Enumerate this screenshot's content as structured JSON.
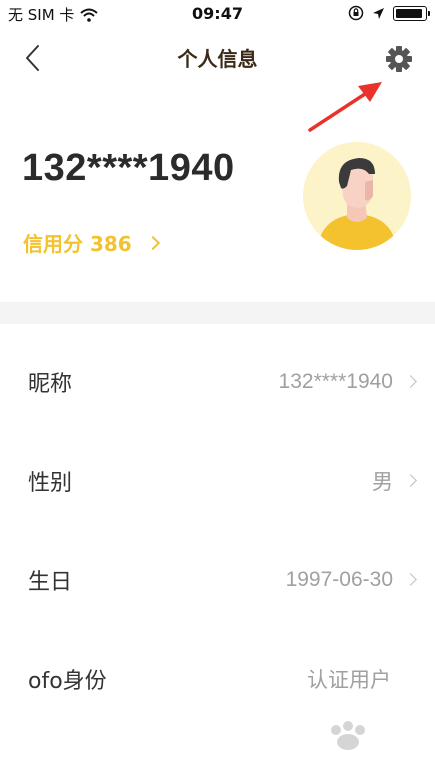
{
  "status_bar": {
    "carrier": "无 SIM 卡",
    "time": "09:47"
  },
  "nav": {
    "title": "个人信息"
  },
  "profile": {
    "phone_masked": "132****1940",
    "credit_label": "信用分 386"
  },
  "info_rows": [
    {
      "label": "昵称",
      "value": "132****1940",
      "has_chevron": true
    },
    {
      "label": "性别",
      "value": "男",
      "has_chevron": true
    },
    {
      "label": "生日",
      "value": "1997-06-30",
      "has_chevron": true
    },
    {
      "label": "ofo身份",
      "value": "认证用户",
      "has_chevron": false
    }
  ],
  "colors": {
    "accent_yellow": "#f2c230",
    "annotation_red": "#e8322b",
    "title_brown": "#3a2a16"
  },
  "icons": [
    "back-icon",
    "gear-icon",
    "chevron-right-icon",
    "wifi-icon",
    "lock-rotation-icon",
    "location-icon",
    "battery-icon",
    "avatar-illustration"
  ]
}
